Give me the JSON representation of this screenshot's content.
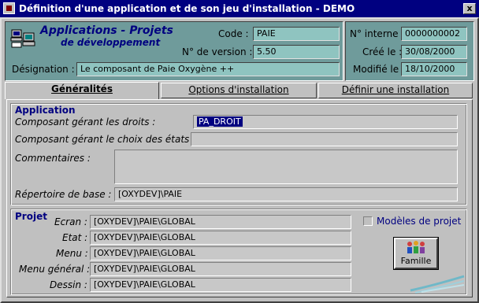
{
  "window": {
    "title": "Définition d'une application et de son jeu d'installation - DEMO",
    "close_label": "x"
  },
  "header": {
    "app_title_line1": "Applications - Projets",
    "app_title_line2": "de développement",
    "code_label": "Code :",
    "code_value": "PAIE",
    "version_label": "N° de version :",
    "version_value": "5.50",
    "designation_label": "Désignation :",
    "designation_value": "Le composant de Paie Oxygène ++",
    "internal_no_label": "N° interne :",
    "internal_no_value": "0000000002",
    "created_label": "Créé le :",
    "created_value": "30/08/2000",
    "modified_label": "Modifié le :",
    "modified_value": "18/10/2000"
  },
  "tabs": [
    {
      "label": "Généralités",
      "active": true
    },
    {
      "label": "Options d'installation",
      "active": false
    },
    {
      "label": "Définir une installation",
      "active": false
    }
  ],
  "application": {
    "group_title": "Application",
    "rights_label": "Composant gérant les droits :",
    "rights_value": "PA_DROIT",
    "states_label": "Composant gérant le choix des états :",
    "states_value": "",
    "comments_label": "Commentaires :",
    "comments_value": "",
    "base_dir_label": "Répertoire de base :",
    "base_dir_value": "[OXYDEV]\\PAIE"
  },
  "projet": {
    "group_title": "Projet",
    "ecran_label": "Ecran :",
    "ecran_value": "[OXYDEV]\\PAIE\\GLOBAL",
    "etat_label": "Etat :",
    "etat_value": "[OXYDEV]\\PAIE\\GLOBAL",
    "menu_label": "Menu :",
    "menu_value": "[OXYDEV]\\PAIE\\GLOBAL",
    "menu_general_label": "Menu général :",
    "menu_general_value": "[OXYDEV]\\PAIE\\GLOBAL",
    "dessin_label": "Dessin :",
    "dessin_value": "[OXYDEV]\\PAIE\\GLOBAL",
    "modeles_label": "Modèles de projet",
    "modeles_checked": false,
    "famille_label": "Famille"
  },
  "icons": {
    "window_icon": "app-window-icon",
    "header_icon": "computers-icon",
    "famille_icon": "people-group-icon",
    "corner_deco": "swoosh-decoration"
  },
  "colors": {
    "titlebar": "#000080",
    "header_bg": "#6f9b9b",
    "teal_field": "#8fc4c0",
    "group_title": "#000080"
  }
}
